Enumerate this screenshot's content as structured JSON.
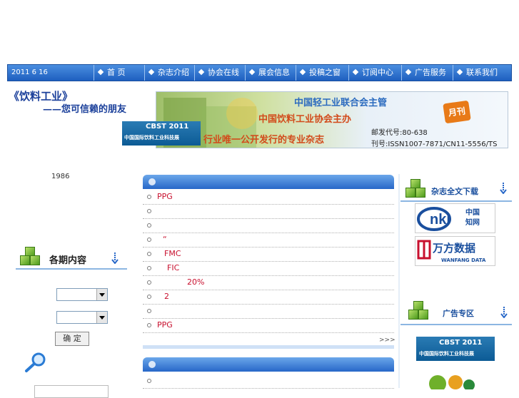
{
  "nav": {
    "date": "2011 6 16",
    "items": [
      "首 页",
      "杂志介绍",
      "协会在线",
      "展会信息",
      "投稿之窗",
      "订阅中心",
      "广告服务",
      "联系我们"
    ]
  },
  "header": {
    "logo_line1": "《饮料工业》",
    "logo_line2": "——您可信赖的朋友",
    "banner_line1": "中国轻工业联合会主管",
    "banner_line2": "中国饮料工业协会主办",
    "banner_line3": "行业唯一公开发行的专业杂志",
    "monthly": "月刊",
    "postal_code": "邮发代号:80-638",
    "issn": "刊号:ISSN1007-7871/CN11-5556/TS",
    "cbst_title": "CBST 2011",
    "cbst_sub": "中国国际饮料工业科技展"
  },
  "left": {
    "year": "1986",
    "issues_title": "各期内容",
    "confirm": "确 定"
  },
  "main": {
    "rows": [
      "PPG",
      "",
      "",
      "“",
      "FMC",
      "FIC",
      "20%",
      "2",
      "",
      "PPG"
    ],
    "more": ">>>"
  },
  "right": {
    "download_title": "杂志全文下载",
    "ads_title": "广告专区",
    "cnki_label": "中国知网",
    "wanfang_label": "万方数据",
    "wanfang_sub": "WANFANG DATA",
    "cbst_title": "CBST 2011",
    "cbst_sub": "中国国际饮料工业科技展"
  },
  "colors": {
    "nav": "#2a6fcf",
    "accent_red": "#c8102e",
    "panel_head": "#3f82d8"
  }
}
